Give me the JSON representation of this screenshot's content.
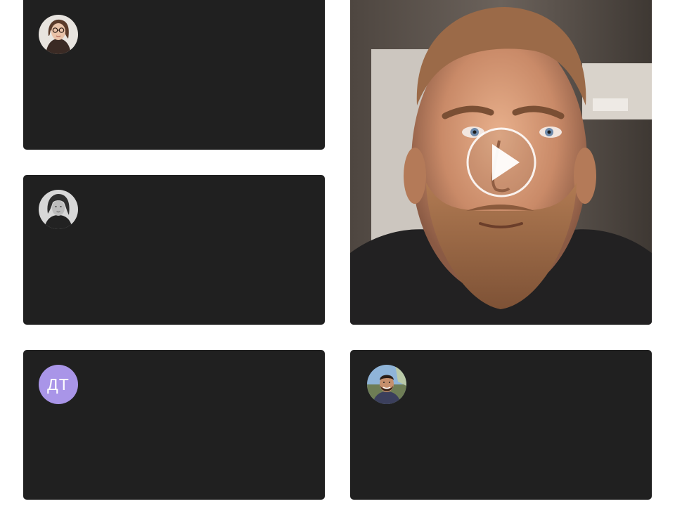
{
  "participants": [
    {
      "id": "p1",
      "avatar_type": "photo",
      "avatar_icon": "woman-glasses-photo"
    },
    {
      "id": "p2",
      "avatar_type": "photo",
      "avatar_icon": "woman-bw-photo"
    },
    {
      "id": "p3",
      "avatar_type": "initials",
      "initials": "ДТ",
      "avatar_color": "#a995e8"
    },
    {
      "id": "p4",
      "avatar_type": "photo",
      "avatar_icon": "man-smiling-photo"
    }
  ],
  "video": {
    "state": "paused",
    "play_icon": "play-icon"
  },
  "colors": {
    "tile_background": "#202020",
    "page_background": "#ffffff"
  }
}
